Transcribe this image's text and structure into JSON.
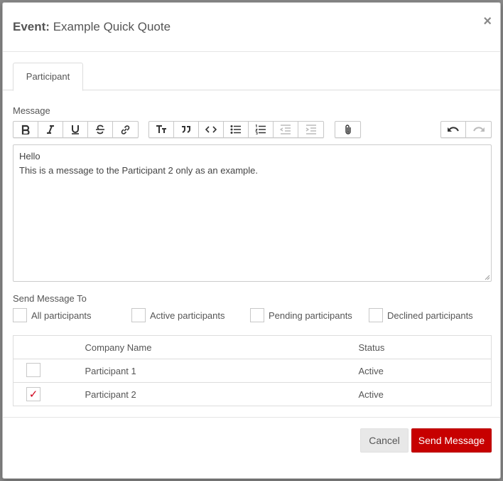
{
  "modal": {
    "title_prefix": "Event:",
    "title_name": "Example Quick Quote",
    "close_symbol": "×"
  },
  "tabs": [
    {
      "label": "Participant",
      "active": true
    }
  ],
  "message": {
    "label": "Message",
    "lines": [
      "Hello",
      "This is a message to the Participant 2 only as an example."
    ]
  },
  "toolbar": {
    "icons": [
      "bold-icon",
      "italic-icon",
      "underline-icon",
      "strikethrough-icon",
      "link-icon",
      "font-size-icon",
      "quote-icon",
      "code-icon",
      "bullet-list-icon",
      "numbered-list-icon",
      "outdent-icon",
      "indent-icon",
      "attachment-icon",
      "undo-icon",
      "redo-icon"
    ]
  },
  "send_to": {
    "label": "Send Message To",
    "options": [
      {
        "label": "All participants",
        "checked": false
      },
      {
        "label": "Active participants",
        "checked": false
      },
      {
        "label": "Pending participants",
        "checked": false
      },
      {
        "label": "Declined participants",
        "checked": false
      }
    ]
  },
  "table": {
    "headers": [
      "",
      "Company Name",
      "Status"
    ],
    "rows": [
      {
        "name": "Participant 1",
        "status": "Active",
        "checked": false
      },
      {
        "name": "Participant 2",
        "status": "Active",
        "checked": true
      }
    ],
    "check_symbol": "✓"
  },
  "footer": {
    "cancel_label": "Cancel",
    "send_label": "Send Message"
  },
  "colors": {
    "primary": "#c70000",
    "check": "#d0021b"
  }
}
